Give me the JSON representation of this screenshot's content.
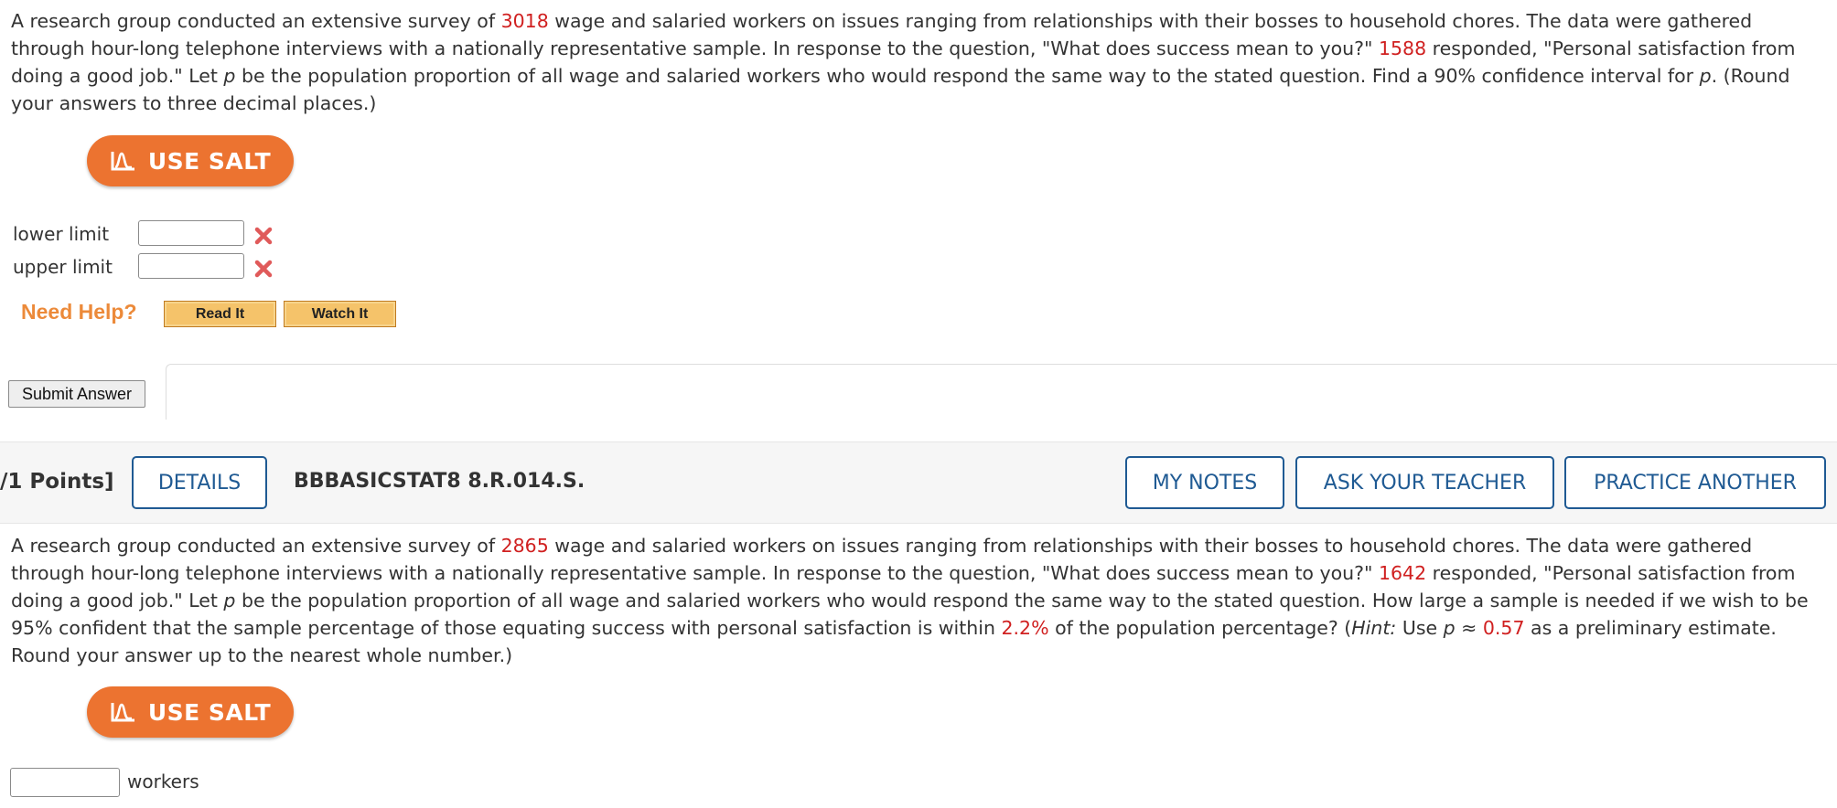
{
  "question1": {
    "text_a": "A research group conducted an extensive survey of ",
    "sample_size": "3018",
    "text_b": " wage and salaried workers on issues ranging from relationships with their bosses to household chores. The data were gathered through hour-long telephone interviews with a nationally representative sample. In response to the question, \"What does success mean to you?\" ",
    "responded": "1588",
    "text_c": " responded, \"Personal satisfaction from doing a good job.\" Let ",
    "p": "p",
    "text_d": " be the population proportion of all wage and salaried workers who would respond the same way to the stated question. Find a 90% confidence interval for ",
    "text_e": ". (Round your answers to three decimal places.)",
    "salt_label": "USE SALT",
    "lower_label": "lower limit",
    "upper_label": "upper limit",
    "lower_value": "",
    "upper_value": "",
    "need_help": "Need Help?",
    "read_it": "Read It",
    "watch_it": "Watch It",
    "submit": "Submit Answer"
  },
  "question2_header": {
    "points": "/1 Points]",
    "details": "DETAILS",
    "code": "BBBASICSTAT8 8.R.014.S.",
    "my_notes": "MY NOTES",
    "ask_teacher": "ASK YOUR TEACHER",
    "practice": "PRACTICE ANOTHER"
  },
  "question2": {
    "text_a": "A research group conducted an extensive survey of ",
    "sample_size": "2865",
    "text_b": " wage and salaried workers on issues ranging from relationships with their bosses to household chores. The data were gathered through hour-long telephone interviews with a nationally representative sample. In response to the question, \"What does success mean to you?\" ",
    "responded": "1642",
    "text_c": " responded, \"Personal satisfaction from doing a good job.\" Let ",
    "p": "p",
    "text_d": " be the population proportion of all wage and salaried workers who would respond the same way to the stated question. How large a sample is needed if we wish to be 95% confident that the sample percentage of those equating success with personal satisfaction is within ",
    "margin": "2.2%",
    "text_e": " of the population percentage? (",
    "hint": "Hint:",
    "text_f": " Use ",
    "approx": " ≈ ",
    "estimate": "0.57",
    "text_g": " as a preliminary estimate. Round your answer up to the nearest whole number.)",
    "salt_label": "USE SALT",
    "answer_value": "",
    "unit_label": "workers"
  },
  "colors": {
    "highlight": "#d02020",
    "salt_orange": "#ec7330",
    "header_blue": "#1f5a93",
    "error_red": "#e05a5a"
  },
  "icons": {
    "salt": "salt-chart-icon",
    "incorrect": "x-mark-icon"
  }
}
